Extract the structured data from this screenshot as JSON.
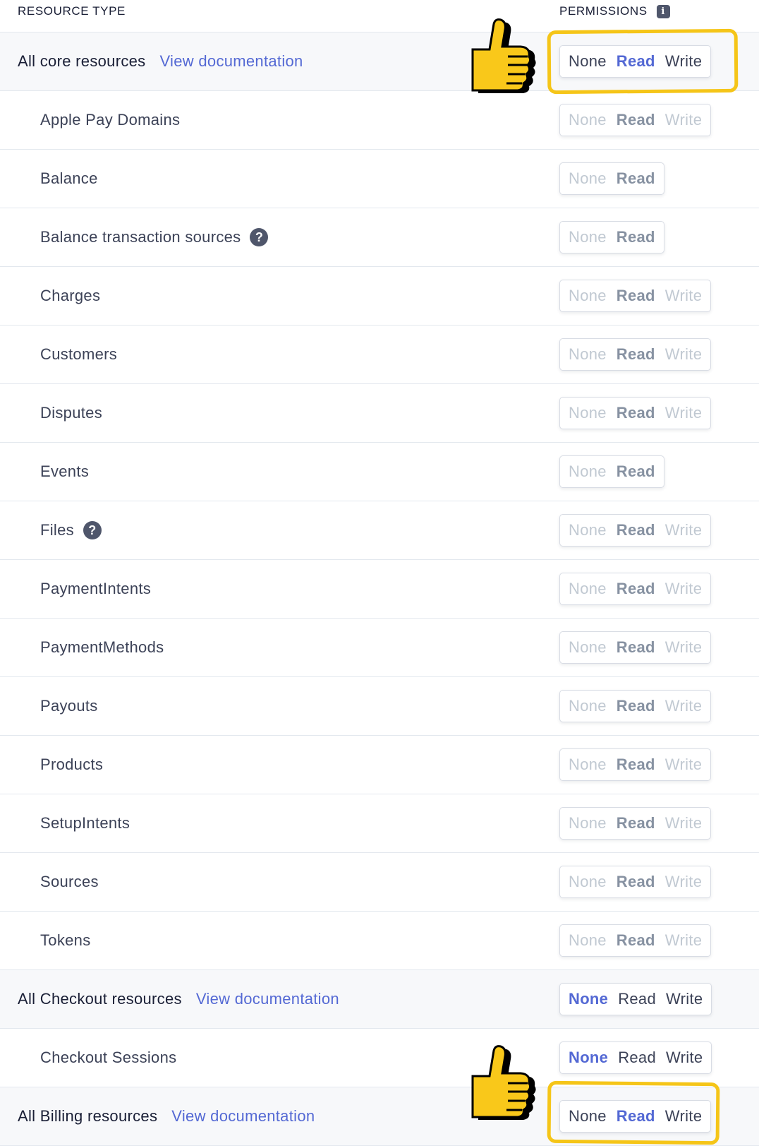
{
  "header": {
    "resource_type": "RESOURCE TYPE",
    "permissions": "PERMISSIONS",
    "info_icon_glyph": "i"
  },
  "doc_link": "View documentation",
  "help_glyph": "?",
  "groups": [
    {
      "label": "All core resources",
      "options": [
        "None",
        "Read",
        "Write"
      ],
      "selected": "Read",
      "items": [
        {
          "label": "Apple Pay Domains",
          "options": [
            "None",
            "Read",
            "Write"
          ],
          "selected": "Read"
        },
        {
          "label": "Balance",
          "options": [
            "None",
            "Read"
          ],
          "selected": "Read"
        },
        {
          "label": "Balance transaction sources",
          "options": [
            "None",
            "Read"
          ],
          "selected": "Read",
          "help": true
        },
        {
          "label": "Charges",
          "options": [
            "None",
            "Read",
            "Write"
          ],
          "selected": "Read"
        },
        {
          "label": "Customers",
          "options": [
            "None",
            "Read",
            "Write"
          ],
          "selected": "Read"
        },
        {
          "label": "Disputes",
          "options": [
            "None",
            "Read",
            "Write"
          ],
          "selected": "Read"
        },
        {
          "label": "Events",
          "options": [
            "None",
            "Read"
          ],
          "selected": "Read"
        },
        {
          "label": "Files",
          "options": [
            "None",
            "Read",
            "Write"
          ],
          "selected": "Read",
          "help": true
        },
        {
          "label": "PaymentIntents",
          "options": [
            "None",
            "Read",
            "Write"
          ],
          "selected": "Read"
        },
        {
          "label": "PaymentMethods",
          "options": [
            "None",
            "Read",
            "Write"
          ],
          "selected": "Read"
        },
        {
          "label": "Payouts",
          "options": [
            "None",
            "Read",
            "Write"
          ],
          "selected": "Read"
        },
        {
          "label": "Products",
          "options": [
            "None",
            "Read",
            "Write"
          ],
          "selected": "Read"
        },
        {
          "label": "SetupIntents",
          "options": [
            "None",
            "Read",
            "Write"
          ],
          "selected": "Read"
        },
        {
          "label": "Sources",
          "options": [
            "None",
            "Read",
            "Write"
          ],
          "selected": "Read"
        },
        {
          "label": "Tokens",
          "options": [
            "None",
            "Read",
            "Write"
          ],
          "selected": "Read"
        }
      ]
    },
    {
      "label": "All Checkout resources",
      "options": [
        "None",
        "Read",
        "Write"
      ],
      "selected": "None",
      "items": [
        {
          "label": "Checkout Sessions",
          "options": [
            "None",
            "Read",
            "Write"
          ],
          "selected": "None",
          "enabled": true
        }
      ]
    },
    {
      "label": "All Billing resources",
      "options": [
        "None",
        "Read",
        "Write"
      ],
      "selected": "Read",
      "items": []
    }
  ],
  "annotations": {
    "highlight_color": "#f5c518",
    "icon": "thumbs-up-icon"
  },
  "colors": {
    "accent": "#5469d4",
    "disabled_text": "#c1c9d2",
    "group_bg": "#f7f8fa"
  }
}
